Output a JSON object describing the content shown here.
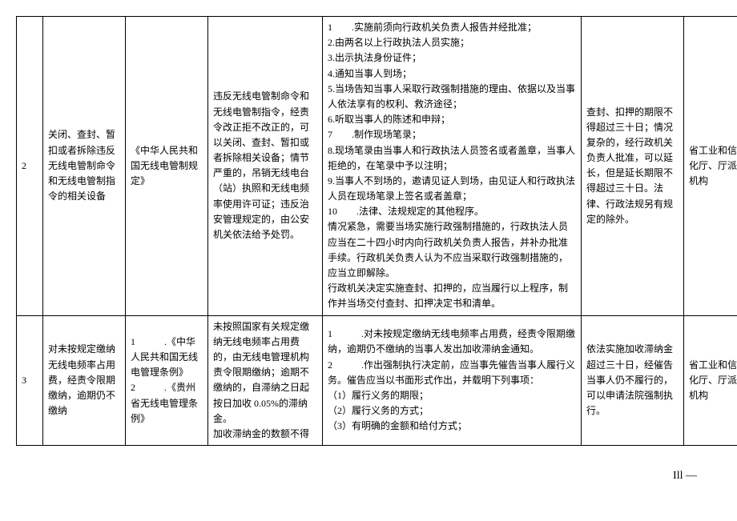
{
  "rows": [
    {
      "num": "2",
      "item": "关闭、查封、暂扣或者拆除违反无线电管制命令和无线电管制指令的相关设备",
      "basis": "《中华人民共和国无线电管制规定》",
      "condition": "违反无线电管制命令和无线电管制指令，经责令改正拒不改正的，可以关闭、查封、暂扣或者拆除相关设备；情节严重的，吊销无线电台（站）执照和无线电频率使用许可证；违反治安管理规定的，由公安机关依法给予处罚。",
      "procedure": "1　　.实施前须向行政机关负责人报告并经批准；\n2.由两名以上行政执法人员实施；\n3.出示执法身份证件；\n4.通知当事人到场；\n5.当场告知当事人采取行政强制措施的理由、依据以及当事人依法享有的权利、救济途径；\n6.听取当事人的陈述和申辩；\n7　　.制作现场笔录；\n8.现场笔录由当事人和行政执法人员签名或者盖章，当事人拒绝的，在笔录中予以注明；\n9.当事人不到场的，邀请见证人到场，由见证人和行政执法人员在现场笔录上签名或者盖章；\n10　　.法律、法规规定的其他程序。\n情况紧急，需要当场实施行政强制措施的，行政执法人员应当在二十四小时内向行政机关负责人报告，并补办批准手续。行政机关负责人认为不应当采取行政强制措施的，应当立即解除。\n行政机关决定实施查封、扣押的，应当履行以上程序，制作并当场交付查封、扣押决定书和清单。",
      "deadline": "查封、扣押的期限不得超过三十日；情况复杂的，经行政机关负责人批准，可以延长，但是延长期限不得超过三十日。法律、行政法规另有规定的除外。",
      "agency": "省工业和信息化厅、厅派出机构"
    },
    {
      "num": "3",
      "item": "对未按规定缴纳无线电频率占用费，经责令限期缴纳，逾期仍不缴纳",
      "basis": "1　　　.《中华人民共和国无线电管理条例》\n2　　　.《贵州省无线电管理条例》",
      "condition": "未按照国家有关规定缴纳无线电频率占用费的，由无线电管理机构责令限期缴纳；逾期不缴纳的，自滞纳之日起按日加收 0.05%的滞纳金。\n加收滞纳金的数额不得",
      "procedure": "1　　　.对未按规定缴纳无线电频率占用费，经责令限期缴纳，逾期仍不缴纳的当事人发出加收滞纳金通知。\n2　　　.作出强制执行决定前，应当事先催告当事人履行义务。催告应当以书面形式作出，并载明下列事项：\n（1）履行义务的期限；\n（2）履行义务的方式；\n（3）有明确的金额和给付方式；",
      "deadline": "依法实施加收滞纳金超过三十日，经催告当事人仍不履行的，可以申请法院强制执行。",
      "agency": "省工业和信息化厅、厅派出机构"
    }
  ],
  "pageNum": "Ill —"
}
